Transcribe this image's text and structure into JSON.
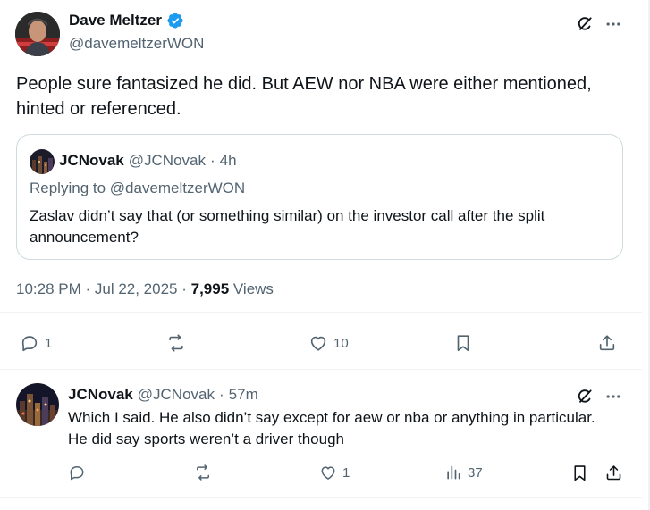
{
  "main_tweet": {
    "author_name": "Dave Meltzer",
    "author_handle": "@davemeltzerWON",
    "text": "People sure fantasized he did.  But AEW nor NBA were either mentioned, hinted or referenced.",
    "timestamp": "10:28 PM · Jul 22, 2025 · ",
    "views_count": "7,995",
    "views_label": " Views",
    "actions": {
      "replies": "1",
      "likes": "10"
    }
  },
  "quoted_tweet": {
    "author_name": "JCNovak",
    "author_handle": "@JCNovak",
    "separator": "·",
    "time": "4h",
    "replying_to": "Replying to @davemeltzerWON",
    "text": "Zaslav didn’t say that (or something similar) on the investor call after the split announcement?"
  },
  "reply_tweet": {
    "author_name": "JCNovak",
    "author_handle": "@JCNovak",
    "separator": "·",
    "time": "57m",
    "text": "Which I said.  He also didn’t say except for aew or nba or anything in particular.  He did say sports weren’t a driver though",
    "actions": {
      "likes": "1",
      "views": "37"
    }
  },
  "colors": {
    "verified_badge": "#1d9bf0",
    "muted_text": "#536471",
    "border": "#cfd9de",
    "primary_text": "#0f1419"
  }
}
